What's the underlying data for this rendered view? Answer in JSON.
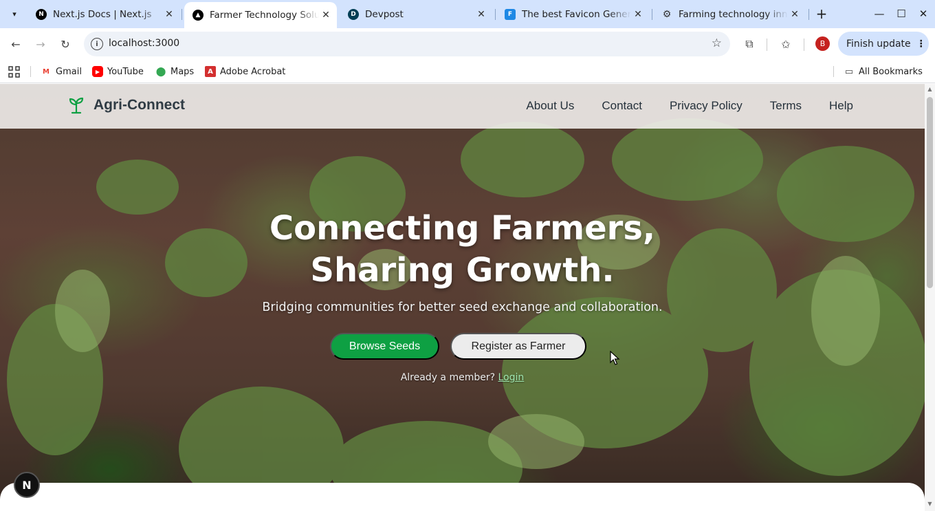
{
  "browser": {
    "tabs": [
      {
        "title": "Next.js Docs | Next.js",
        "favicon": "nextjs-favicon",
        "active": false
      },
      {
        "title": "Farmer Technology Solutions",
        "favicon": "vercel-triangle-favicon",
        "active": true
      },
      {
        "title": "Devpost",
        "favicon": "devpost-favicon",
        "active": false
      },
      {
        "title": "The best Favicon Generator",
        "favicon": "favicon-generator-favicon",
        "active": false
      },
      {
        "title": "Farming technology innovation",
        "favicon": "openai-favicon",
        "active": false
      }
    ],
    "url": "localhost:3000",
    "profile_initial": "B",
    "finish_update_label": "Finish update",
    "bookmarks": [
      {
        "label": "Gmail",
        "icon": "gmail-icon"
      },
      {
        "label": "YouTube",
        "icon": "youtube-icon"
      },
      {
        "label": "Maps",
        "icon": "maps-icon"
      },
      {
        "label": "Adobe Acrobat",
        "icon": "acrobat-icon"
      }
    ],
    "all_bookmarks_label": "All Bookmarks"
  },
  "site": {
    "brand": "Agri-Connect",
    "brand_icon": "sprout-icon",
    "brand_color": "#0ea043",
    "nav": [
      "About Us",
      "Contact",
      "Privacy Policy",
      "Terms",
      "Help"
    ],
    "hero": {
      "headline_line1": "Connecting Farmers,",
      "headline_line2": "Sharing Growth.",
      "subheadline": "Bridging communities for better seed exchange and collaboration.",
      "primary_cta": "Browse Seeds",
      "secondary_cta": "Register as Farmer",
      "member_prompt": "Already a member?",
      "login_link": "Login"
    },
    "dev_badge": "N"
  }
}
